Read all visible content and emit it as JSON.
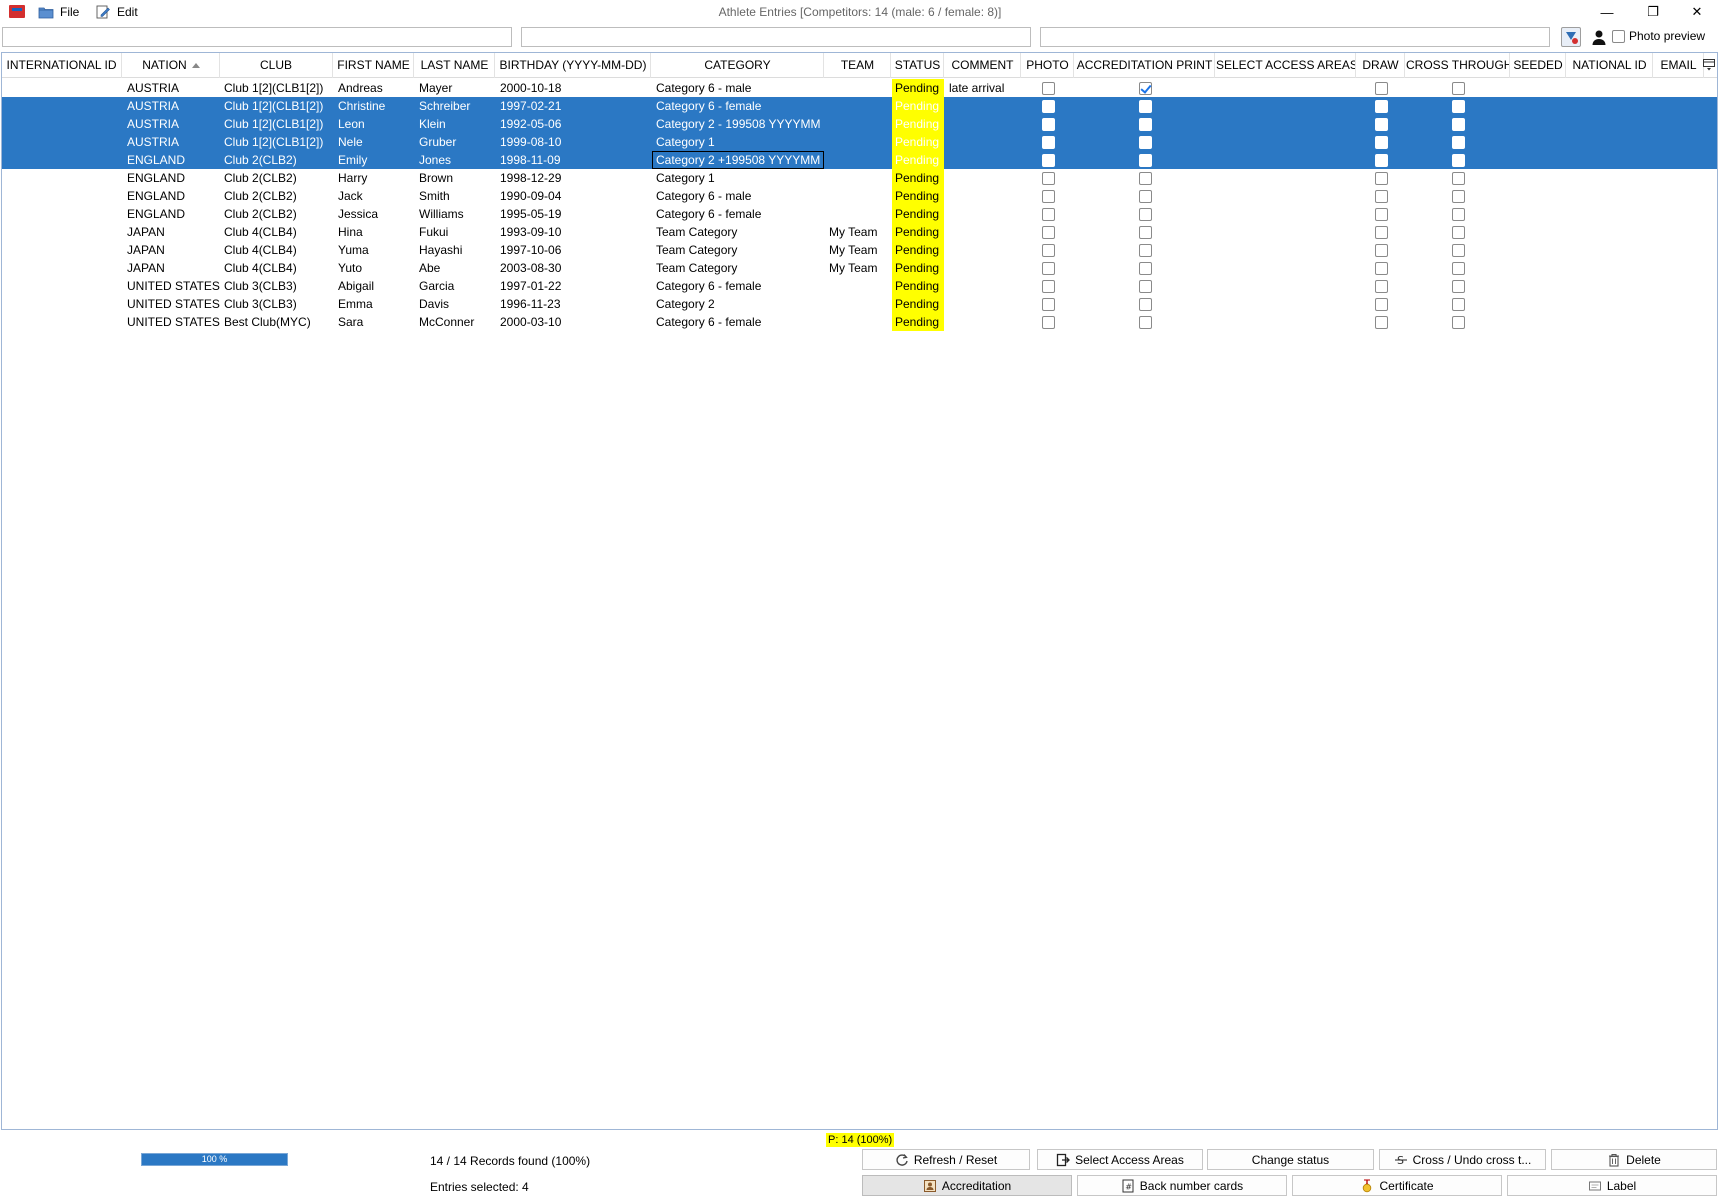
{
  "window": {
    "title": "Athlete Entries [Competitors: 14 (male: 6 / female: 8)]",
    "minimize": "—",
    "restore": "❐",
    "close": "✕"
  },
  "menu": {
    "file": "File",
    "edit": "Edit"
  },
  "filters": {
    "filter1": "",
    "filter2": "",
    "filter3": ""
  },
  "photo_preview": {
    "label": "Photo preview",
    "checked": false
  },
  "columns": [
    {
      "key": "international_id",
      "label": "INTERNATIONAL ID"
    },
    {
      "key": "nation",
      "label": "NATION",
      "sorted": "asc"
    },
    {
      "key": "club",
      "label": "CLUB"
    },
    {
      "key": "first_name",
      "label": "FIRST NAME"
    },
    {
      "key": "last_name",
      "label": "LAST NAME"
    },
    {
      "key": "birthday",
      "label": "BIRTHDAY (YYYY-MM-DD)"
    },
    {
      "key": "category",
      "label": "CATEGORY"
    },
    {
      "key": "team",
      "label": "TEAM"
    },
    {
      "key": "status",
      "label": "STATUS"
    },
    {
      "key": "comment",
      "label": "COMMENT"
    },
    {
      "key": "photo",
      "label": "PHOTO"
    },
    {
      "key": "accreditation_print",
      "label": "ACCREDITATION PRINT"
    },
    {
      "key": "select_access_areas",
      "label": "SELECT ACCESS AREAS"
    },
    {
      "key": "draw",
      "label": "DRAW"
    },
    {
      "key": "cross_through",
      "label": "CROSS THROUGH"
    },
    {
      "key": "seeded",
      "label": "SEEDED"
    },
    {
      "key": "national_id",
      "label": "NATIONAL ID"
    },
    {
      "key": "email",
      "label": "EMAIL"
    }
  ],
  "rows": [
    {
      "nation": "AUSTRIA",
      "club": "Club 1[2](CLB1[2])",
      "first_name": "Andreas",
      "last_name": "Mayer",
      "birthday": "2000-10-18",
      "category": "Category 6 - male",
      "team": "",
      "status": "Pending",
      "comment": "late arrival",
      "photo": false,
      "accreditation_print": true,
      "draw": false,
      "cross_through": false,
      "selected": false
    },
    {
      "nation": "AUSTRIA",
      "club": "Club 1[2](CLB1[2])",
      "first_name": "Christine",
      "last_name": "Schreiber",
      "birthday": "1997-02-21",
      "category": "Category 6 - female",
      "team": "",
      "status": "Pending",
      "comment": "",
      "photo": false,
      "accreditation_print": false,
      "draw": false,
      "cross_through": false,
      "selected": true
    },
    {
      "nation": "AUSTRIA",
      "club": "Club 1[2](CLB1[2])",
      "first_name": "Leon",
      "last_name": "Klein",
      "birthday": "1992-05-06",
      "category": "Category 2 - 199508 YYYYMM",
      "team": "",
      "status": "Pending",
      "comment": "",
      "photo": false,
      "accreditation_print": false,
      "draw": false,
      "cross_through": false,
      "selected": true
    },
    {
      "nation": "AUSTRIA",
      "club": "Club 1[2](CLB1[2])",
      "first_name": "Nele",
      "last_name": "Gruber",
      "birthday": "1999-08-10",
      "category": "Category 1",
      "team": "",
      "status": "Pending",
      "comment": "",
      "photo": false,
      "accreditation_print": false,
      "draw": false,
      "cross_through": false,
      "selected": true
    },
    {
      "nation": "ENGLAND",
      "club": "Club 2(CLB2)",
      "first_name": "Emily",
      "last_name": "Jones",
      "birthday": "1998-11-09",
      "category": "Category 2 +199508 YYYYMM",
      "team": "",
      "status": "Pending",
      "comment": "",
      "photo": false,
      "accreditation_print": false,
      "draw": false,
      "cross_through": false,
      "selected": true,
      "focused": "category"
    },
    {
      "nation": "ENGLAND",
      "club": "Club 2(CLB2)",
      "first_name": "Harry",
      "last_name": "Brown",
      "birthday": "1998-12-29",
      "category": "Category 1",
      "team": "",
      "status": "Pending",
      "comment": "",
      "photo": false,
      "accreditation_print": false,
      "draw": false,
      "cross_through": false,
      "selected": false
    },
    {
      "nation": "ENGLAND",
      "club": "Club 2(CLB2)",
      "first_name": "Jack",
      "last_name": "Smith",
      "birthday": "1990-09-04",
      "category": "Category 6 - male",
      "team": "",
      "status": "Pending",
      "comment": "",
      "photo": false,
      "accreditation_print": false,
      "draw": false,
      "cross_through": false,
      "selected": false
    },
    {
      "nation": "ENGLAND",
      "club": "Club 2(CLB2)",
      "first_name": "Jessica",
      "last_name": "Williams",
      "birthday": "1995-05-19",
      "category": "Category 6 - female",
      "team": "",
      "status": "Pending",
      "comment": "",
      "photo": false,
      "accreditation_print": false,
      "draw": false,
      "cross_through": false,
      "selected": false
    },
    {
      "nation": "JAPAN",
      "club": "Club 4(CLB4)",
      "first_name": "Hina",
      "last_name": "Fukui",
      "birthday": "1993-09-10",
      "category": "Team Category",
      "team": "My Team",
      "status": "Pending",
      "comment": "",
      "photo": false,
      "accreditation_print": false,
      "draw": false,
      "cross_through": false,
      "selected": false
    },
    {
      "nation": "JAPAN",
      "club": "Club 4(CLB4)",
      "first_name": "Yuma",
      "last_name": "Hayashi",
      "birthday": "1997-10-06",
      "category": "Team Category",
      "team": "My Team",
      "status": "Pending",
      "comment": "",
      "photo": false,
      "accreditation_print": false,
      "draw": false,
      "cross_through": false,
      "selected": false
    },
    {
      "nation": "JAPAN",
      "club": "Club 4(CLB4)",
      "first_name": "Yuto",
      "last_name": "Abe",
      "birthday": "2003-08-30",
      "category": "Team Category",
      "team": "My Team",
      "status": "Pending",
      "comment": "",
      "photo": false,
      "accreditation_print": false,
      "draw": false,
      "cross_through": false,
      "selected": false
    },
    {
      "nation": "UNITED STATES",
      "club": "Club 3(CLB3)",
      "first_name": "Abigail",
      "last_name": "Garcia",
      "birthday": "1997-01-22",
      "category": "Category 6 - female",
      "team": "",
      "status": "Pending",
      "comment": "",
      "photo": false,
      "accreditation_print": false,
      "draw": false,
      "cross_through": false,
      "selected": false
    },
    {
      "nation": "UNITED STATES",
      "club": "Club 3(CLB3)",
      "first_name": "Emma",
      "last_name": "Davis",
      "birthday": "1996-11-23",
      "category": "Category 2",
      "team": "",
      "status": "Pending",
      "comment": "",
      "photo": false,
      "accreditation_print": false,
      "draw": false,
      "cross_through": false,
      "selected": false
    },
    {
      "nation": "UNITED STATES",
      "club": "Best Club(MYC)",
      "first_name": "Sara",
      "last_name": "McConner",
      "birthday": "2000-03-10",
      "category": "Category 6 - female",
      "team": "",
      "status": "Pending",
      "comment": "",
      "photo": false,
      "accreditation_print": false,
      "draw": false,
      "cross_through": false,
      "selected": false
    }
  ],
  "status_colors": {
    "pending_bg": "#ffff00",
    "selected_row_bg": "#2b78c4"
  },
  "footer": {
    "pending_badge": "P: 14 (100%)",
    "progress_text": "100 %",
    "progress_fraction": 1.0,
    "records_found": "14 / 14 Records found (100%)",
    "entries_selected": "Entries selected: 4"
  },
  "buttons": {
    "refresh": "Refresh / Reset",
    "select_access_areas": "Select Access Areas",
    "change_status": "Change status",
    "cross": "Cross / Undo cross t...",
    "delete": "Delete",
    "accreditation": "Accreditation",
    "back_number_cards": "Back number cards",
    "certificate": "Certificate",
    "label": "Label"
  }
}
